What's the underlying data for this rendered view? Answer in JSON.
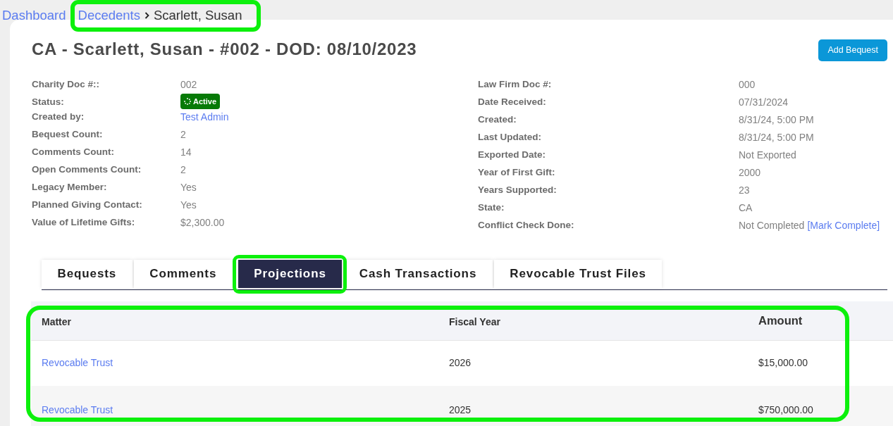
{
  "breadcrumb": {
    "items": [
      {
        "label": "Dashboard",
        "current": false,
        "highlighted": false
      },
      {
        "label": "Decedents",
        "current": false,
        "highlighted": true
      },
      {
        "label": "Scarlett, Susan",
        "current": true,
        "highlighted": true
      }
    ]
  },
  "title": "CA - Scarlett, Susan - #002 - DOD: 08/10/2023",
  "add_button": "Add Bequest",
  "details": {
    "left": [
      {
        "label": "Charity Doc #::",
        "value": "002",
        "kind": "text"
      },
      {
        "label": "Status:",
        "value": "Active",
        "kind": "badge"
      },
      {
        "label": "Created by:",
        "value": "Test Admin",
        "kind": "link"
      },
      {
        "label": "Bequest Count:",
        "value": "2",
        "kind": "text"
      },
      {
        "label": "Comments Count:",
        "value": "14",
        "kind": "text"
      },
      {
        "label": "Open Comments Count:",
        "value": "2",
        "kind": "text"
      },
      {
        "label": "Legacy Member:",
        "value": "Yes",
        "kind": "text"
      },
      {
        "label": "Planned Giving Contact:",
        "value": "Yes",
        "kind": "text"
      },
      {
        "label": "Value of Lifetime Gifts:",
        "value": "$2,300.00",
        "kind": "text"
      }
    ],
    "right": [
      {
        "label": "Law Firm Doc #:",
        "value": "000",
        "kind": "text"
      },
      {
        "label": "Date Received:",
        "value": "07/31/2024",
        "kind": "text"
      },
      {
        "label": "Created:",
        "value": "8/31/24, 5:00 PM",
        "kind": "text"
      },
      {
        "label": "Last Updated:",
        "value": "8/31/24, 5:00 PM",
        "kind": "text"
      },
      {
        "label": "Exported Date:",
        "value": "Not Exported",
        "kind": "text"
      },
      {
        "label": "Year of First Gift:",
        "value": "2000",
        "kind": "text"
      },
      {
        "label": "Years Supported:",
        "value": "23",
        "kind": "text"
      },
      {
        "label": "State:",
        "value": "CA",
        "kind": "text"
      },
      {
        "label": "Conflict Check Done:",
        "value": "Not Completed",
        "kind": "action",
        "action": "[Mark Complete]"
      }
    ]
  },
  "tabs": [
    {
      "label": "Bequests",
      "selected": false,
      "highlighted": false
    },
    {
      "label": "Comments",
      "selected": false,
      "highlighted": false
    },
    {
      "label": "Projections",
      "selected": true,
      "highlighted": true
    },
    {
      "label": "Cash Transactions",
      "selected": false,
      "highlighted": false
    },
    {
      "label": "Revocable Trust Files",
      "selected": false,
      "highlighted": false
    }
  ],
  "table": {
    "highlighted": true,
    "columns": [
      {
        "label": "Matter",
        "kind": "link"
      },
      {
        "label": "Fiscal Year",
        "kind": "text"
      },
      {
        "label": "Amount",
        "kind": "text"
      }
    ],
    "rows": [
      [
        "Revocable Trust",
        "2026",
        "$15,000.00"
      ],
      [
        "Revocable Trust",
        "2025",
        "$750,000.00"
      ]
    ]
  }
}
